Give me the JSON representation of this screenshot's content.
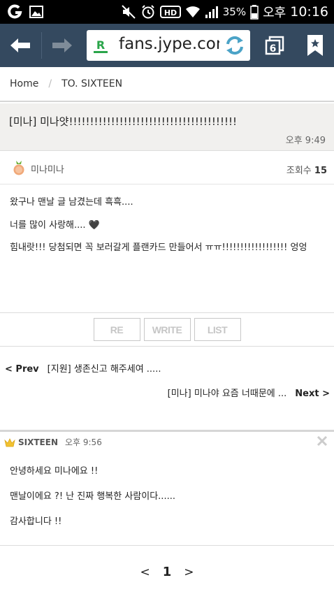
{
  "status_bar": {
    "battery_percent": "35%",
    "ampm": "오후",
    "time": "10:16",
    "hd_label": "HD",
    "icons": [
      "app-g-icon",
      "image-icon",
      "mute-icon",
      "alarm-icon",
      "hd-voice-icon",
      "wifi-icon",
      "signal-icon",
      "battery-icon"
    ]
  },
  "browser": {
    "url": "fans.jype.com",
    "favicon_label": "R",
    "icons": [
      "back-arrow-icon",
      "forward-arrow-icon",
      "reload-icon",
      "tabs-icon",
      "bookmark-icon"
    ],
    "tabs_count": "6"
  },
  "breadcrumb": {
    "home": "Home",
    "separator": "/",
    "current": "TO. SIXTEEN"
  },
  "post": {
    "title": "[미나] 미나얏!!!!!!!!!!!!!!!!!!!!!!!!!!!!!!!!!!!!!!!!",
    "time": "오후 9:49",
    "author": "미나미나",
    "views_label": "조회수",
    "views": "15",
    "body": [
      "왔구나 맨날 글 남겼는데 흑흑....",
      "너를 많이 사랑해.... 🖤",
      "힘내랏!!! 당첨되면 꼭 보러갈게 플랜카드 만들어서 ㅠㅠ!!!!!!!!!!!!!!!!!! 엉엉"
    ]
  },
  "actions": {
    "re": "RE",
    "write": "WRITE",
    "list": "LIST"
  },
  "navigation": {
    "prev_label": "< Prev",
    "prev_title": "[지원] 생존신고 해주세여 .....",
    "next_title": "[미나] 미나야 요즘 너때문에 ...",
    "next_label": "Next >"
  },
  "comment": {
    "author": "SIXTEEN",
    "time": "오후 9:56",
    "lines": [
      "안녕하세요 미나에요 !!",
      "맨날이에요 ?! 난 진짜 행복한 사람이다......",
      "감사합니다 !!"
    ]
  },
  "pagination": {
    "prev": "<",
    "current": "1",
    "next": ">"
  },
  "colors": {
    "toolbar": "#34495f",
    "header_bg": "#f1f0ee",
    "favicon_green": "#2aa54a",
    "reload_blue": "#4ba3c7",
    "star_gold": "#f2c230"
  }
}
